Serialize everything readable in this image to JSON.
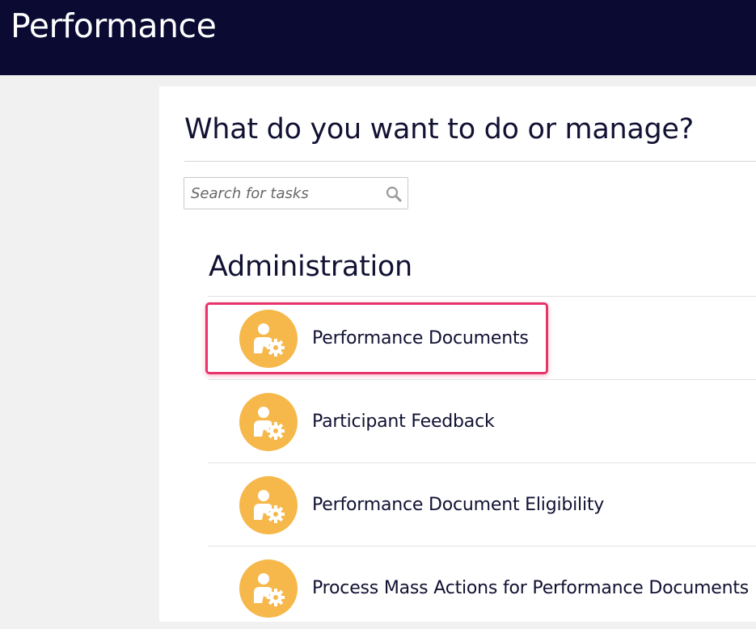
{
  "header": {
    "title": "Performance"
  },
  "main": {
    "title": "What do you want to do or manage?",
    "search": {
      "placeholder": "Search for tasks",
      "value": ""
    },
    "section": {
      "title": "Administration",
      "items": [
        {
          "label": "Performance Documents",
          "icon": "user-settings-icon",
          "highlighted": true
        },
        {
          "label": "Participant Feedback",
          "icon": "user-settings-icon",
          "highlighted": false
        },
        {
          "label": "Performance Document Eligibility",
          "icon": "user-settings-icon",
          "highlighted": false
        },
        {
          "label": "Process Mass Actions for Performance Documents",
          "icon": "user-settings-icon",
          "highlighted": false
        }
      ]
    }
  },
  "colors": {
    "header_bg": "#0a0a33",
    "icon_bg": "#f6b84a",
    "highlight": "#e8336b"
  }
}
